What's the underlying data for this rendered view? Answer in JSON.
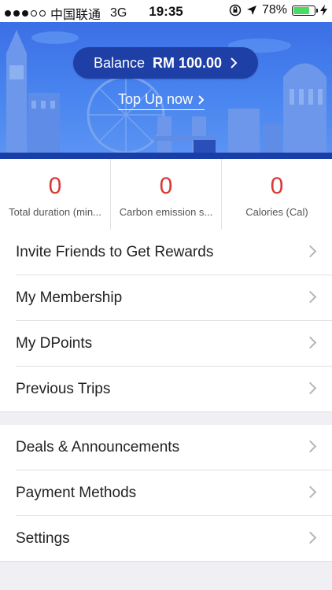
{
  "status_bar": {
    "carrier": "中国联通",
    "network": "3G",
    "time": "19:35",
    "battery": "78%",
    "battery_level": 0.78
  },
  "banner": {
    "balance_label": "Balance",
    "balance_amount": "RM 100.00",
    "topup_label": "Top Up now"
  },
  "stats": [
    {
      "value": "0",
      "label": "Total duration (min..."
    },
    {
      "value": "0",
      "label": "Carbon emission s..."
    },
    {
      "value": "0",
      "label": "Calories (Cal)"
    }
  ],
  "menu_group_1": [
    {
      "label": "Invite Friends to Get Rewards"
    },
    {
      "label": "My Membership"
    },
    {
      "label": "My DPoints"
    },
    {
      "label": "Previous Trips"
    }
  ],
  "menu_group_2": [
    {
      "label": "Deals & Announcements"
    },
    {
      "label": "Payment Methods"
    },
    {
      "label": "Settings"
    }
  ],
  "colors": {
    "banner": "#4a86f0",
    "pill": "#1d3fa6",
    "stat_value": "#d93a36"
  }
}
